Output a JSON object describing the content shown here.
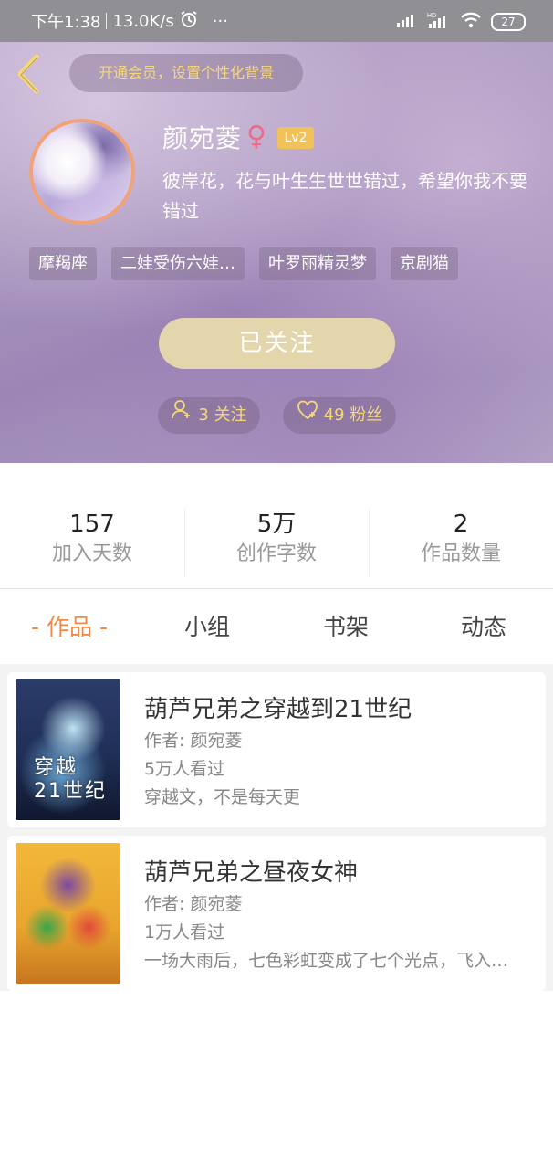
{
  "status_bar": {
    "time": "下午1:38",
    "speed": "13.0K/s",
    "more": "···",
    "battery": "27"
  },
  "header": {
    "vip_prompt": "开通会员，设置个性化背景",
    "username": "颜宛菱",
    "gender_symbol": "♀",
    "level": "Lv2",
    "signature": "彼岸花，花与叶生生世世错过，希望你我不要错过",
    "tags": [
      "摩羯座",
      "二娃受伤六娃…",
      "叶罗丽精灵梦",
      "京剧猫"
    ],
    "follow_button": "已关注",
    "following_count": "3 关注",
    "fans_count": "49 粉丝"
  },
  "stats": [
    {
      "value": "157",
      "label": "加入天数"
    },
    {
      "value": "5万",
      "label": "创作字数"
    },
    {
      "value": "2",
      "label": "作品数量"
    }
  ],
  "tabs": [
    {
      "label": "- 作品 -",
      "active": true
    },
    {
      "label": "小组",
      "active": false
    },
    {
      "label": "书架",
      "active": false
    },
    {
      "label": "动态",
      "active": false
    }
  ],
  "works": [
    {
      "title": "葫芦兄弟之穿越到21世纪",
      "author": "作者: 颜宛菱",
      "views": "5万人看过",
      "desc": "穿越文，不是每天更",
      "cover_text": "穿越\n21世纪"
    },
    {
      "title": "葫芦兄弟之昼夜女神",
      "author": "作者: 颜宛菱",
      "views": "1万人看过",
      "desc": "一场大雨后，七色彩虹变成了七个光点，飞入…"
    }
  ],
  "colors": {
    "accent_orange": "#f08a4b",
    "gold_text": "#f5d77a",
    "follow_button_bg": "#e3d6ad",
    "level_badge": "#f1c15a"
  }
}
